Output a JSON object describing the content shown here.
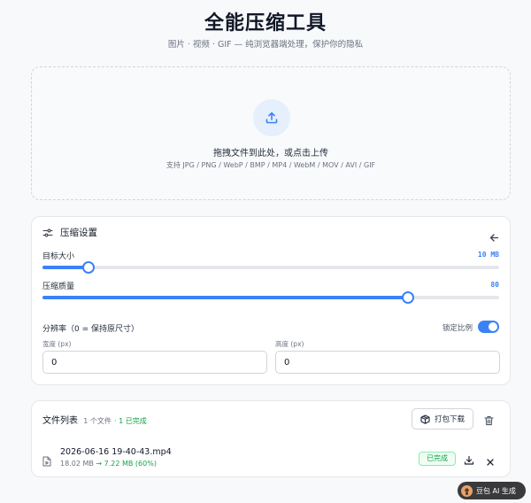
{
  "header": {
    "title": "全能压缩工具",
    "subtitle": "图片 · 视频 · GIF — 纯浏览器端处理，保护你的隐私"
  },
  "dropzone": {
    "icon": "upload-icon",
    "title": "拖拽文件到此处，或点击上传",
    "formats": "支持 JPG / PNG / WebP / BMP / MP4 / WebM / MOV / AVI / GIF"
  },
  "settings": {
    "title": "压缩设置",
    "target_size": {
      "label": "目标大小",
      "value_text": "10 MB",
      "fraction": 0.1
    },
    "quality": {
      "label": "压缩质量",
      "value_text": "80",
      "fraction": 0.8
    },
    "resolution": {
      "label": "分辨率（0 = 保持原尺寸）",
      "lock_label": "锁定比例",
      "lock_on": true,
      "width_label": "宽度 (px)",
      "width_value": "0",
      "height_label": "高度 (px)",
      "height_value": "0"
    }
  },
  "files": {
    "title": "文件列表",
    "count_text": "1 个文件",
    "done_text": "· 1 已完成",
    "pack_label": "打包下载",
    "items": [
      {
        "name": "2026-06-16 19-40-43.mp4",
        "original_size": "18.02 MB",
        "arrow": "→",
        "compressed_size": "7.22 MB (60%)",
        "status": "已完成"
      }
    ]
  },
  "badge": {
    "label": "豆包 AI 生成"
  },
  "colors": {
    "accent": "#3b82f6",
    "success": "#16a34a"
  }
}
